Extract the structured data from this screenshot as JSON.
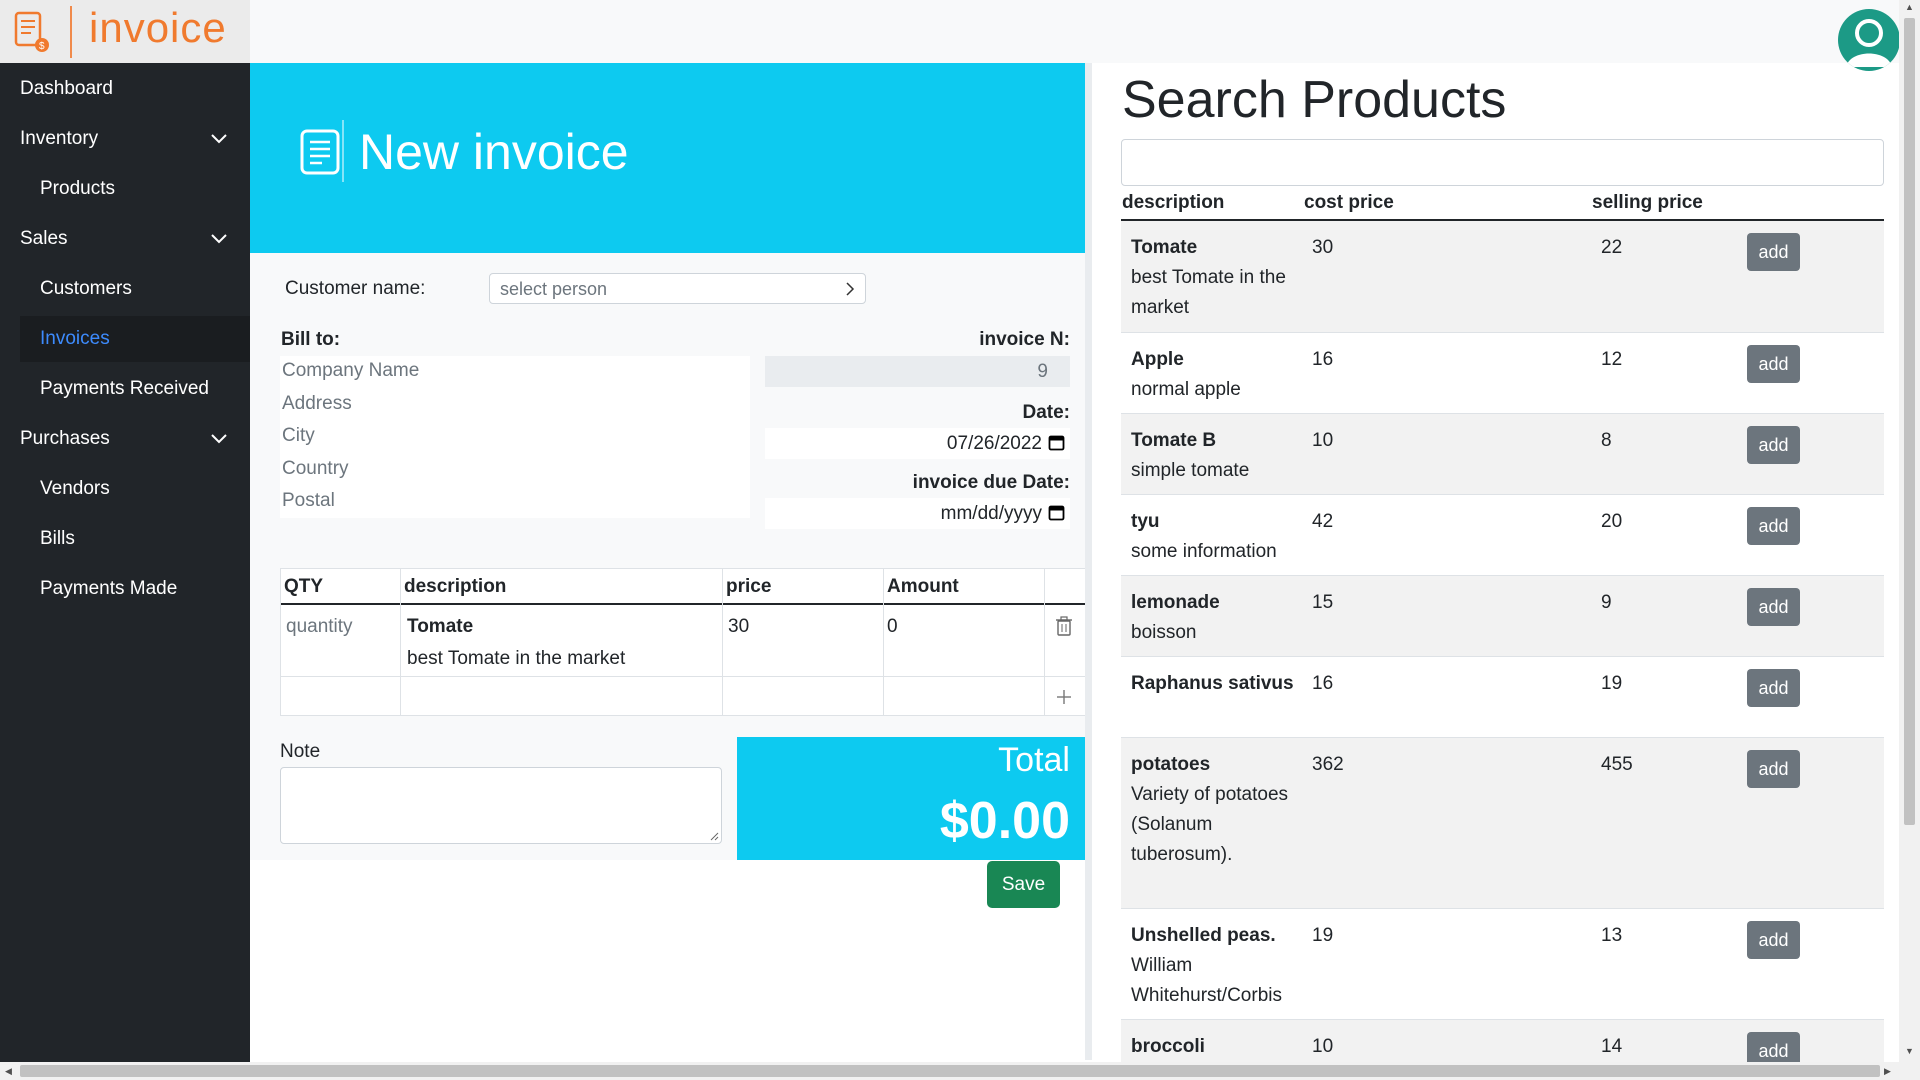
{
  "app": {
    "brand": "invoice"
  },
  "sidebar": {
    "items": [
      {
        "label": "Dashboard"
      },
      {
        "label": "Inventory"
      },
      {
        "label": "Products"
      },
      {
        "label": "Sales"
      },
      {
        "label": "Customers"
      },
      {
        "label": "Invoices"
      },
      {
        "label": "Payments Received"
      },
      {
        "label": "Purchases"
      },
      {
        "label": "Vendors"
      },
      {
        "label": "Bills"
      },
      {
        "label": "Payments Made"
      }
    ]
  },
  "invoice": {
    "title": "New invoice",
    "customer_label": "Customer name:",
    "customer_placeholder": "select person",
    "bill_to_label": "Bill to:",
    "bill_fields": [
      "Company Name",
      "Address",
      "City",
      "Country",
      "Postal"
    ],
    "number_label": "invoice N:",
    "number_value": "9",
    "date_label": "Date:",
    "date_value": "07/26/2022",
    "due_label": "invoice due Date:",
    "due_placeholder": "mm/dd/yyyy",
    "table": {
      "headers": [
        "QTY",
        "description",
        "price",
        "Amount"
      ],
      "rows": [
        {
          "qty_placeholder": "quantity",
          "name": "Tomate",
          "desc": "best Tomate in the market",
          "price": "30",
          "amount": "0"
        }
      ]
    },
    "note_label": "Note",
    "total_label": "Total",
    "total_value": "$0.00",
    "save_label": "Save"
  },
  "products": {
    "title": "Search Products",
    "headers": [
      "description",
      "cost price",
      "selling price"
    ],
    "add_label": "add",
    "rows": [
      {
        "name": "Tomate",
        "desc": "best Tomate in the market",
        "cost": "30",
        "sell": "22"
      },
      {
        "name": "Apple",
        "desc": "normal apple",
        "cost": "16",
        "sell": "12"
      },
      {
        "name": "Tomate B",
        "desc": "simple tomate",
        "cost": "10",
        "sell": "8"
      },
      {
        "name": "tyu",
        "desc": "some information",
        "cost": "42",
        "sell": "20"
      },
      {
        "name": "lemonade",
        "desc": "boisson",
        "cost": "15",
        "sell": "9"
      },
      {
        "name": "Raphanus sativus",
        "desc": "",
        "cost": "16",
        "sell": "19"
      },
      {
        "name": "potatoes",
        "desc": "Variety of potatoes (Solanum tuberosum).",
        "cost": "362",
        "sell": "455"
      },
      {
        "name": "Unshelled peas.",
        "desc": "William Whitehurst/Corbis",
        "cost": "19",
        "sell": "13"
      },
      {
        "name": "broccoli",
        "desc": "",
        "cost": "10",
        "sell": "14"
      }
    ]
  },
  "colors": {
    "accent": "#0dcaf0",
    "brand": "#f07a2e",
    "sidebar": "#212529",
    "save": "#198754",
    "active_link": "#3d8bfd"
  }
}
